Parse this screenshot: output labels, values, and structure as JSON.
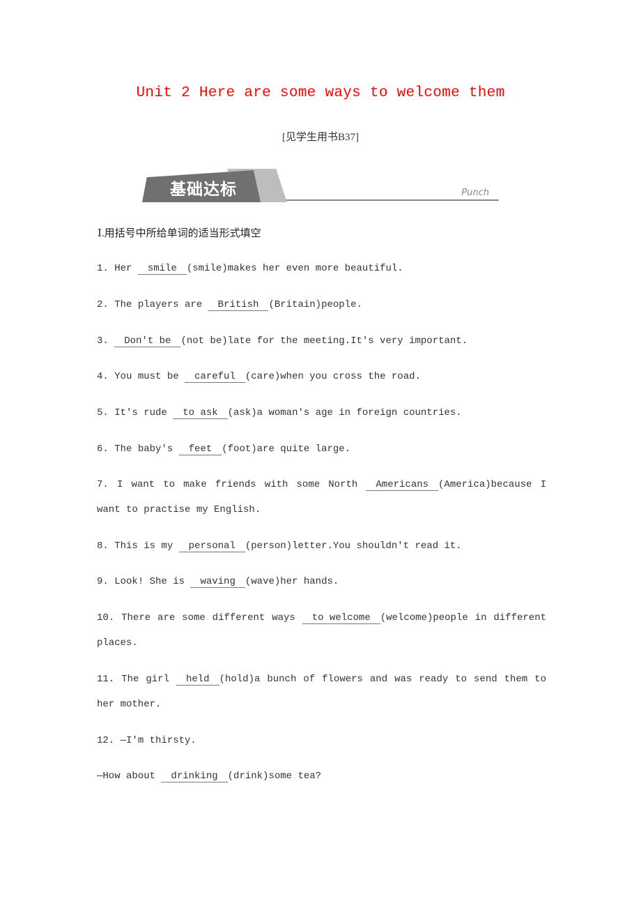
{
  "title": "Unit 2 Here are some ways to welcome them",
  "reference": "[见学生用书B37]",
  "banner": {
    "label": "基础达标",
    "tag": "Punch"
  },
  "section_heading": "Ⅰ.用括号中所给单词的适当形式填空",
  "questions": [
    {
      "num": "1.",
      "before": "Her",
      "answer": "smile",
      "after": "(smile)makes her even more beautiful."
    },
    {
      "num": "2.",
      "before": "The players are",
      "answer": "British",
      "after": "(Britain)people."
    },
    {
      "num": "3.",
      "before": "",
      "answer": "Don't be",
      "after": "(not be)late for the meeting.It's very important."
    },
    {
      "num": "4.",
      "before": "You must be",
      "answer": "careful",
      "after": "(care)when you cross the road."
    },
    {
      "num": "5.",
      "before": "It's rude",
      "answer": "to ask",
      "after": "(ask)a woman's age in foreign countries."
    },
    {
      "num": "6.",
      "before": "The baby's",
      "answer": "feet",
      "after": "(foot)are quite large."
    },
    {
      "num": "7.",
      "before": "I want to make friends with some North",
      "answer": "Americans",
      "after": "(America)because I want to practise my English."
    },
    {
      "num": "8.",
      "before": "This is my",
      "answer": "personal",
      "after": "(person)letter.You shouldn't read it."
    },
    {
      "num": "9.",
      "before": "Look! She is",
      "answer": "waving",
      "after": "(wave)her hands."
    },
    {
      "num": "10.",
      "before": "There are some different ways",
      "answer": "to welcome",
      "after": "(welcome)people in different places."
    },
    {
      "num": "11.",
      "before": "The girl",
      "answer": "held",
      "after": "(hold)a bunch of flowers and was ready to send them to her mother."
    },
    {
      "num": "12.",
      "before": "—I'm thirsty.",
      "answer": "",
      "after": ""
    },
    {
      "num": "",
      "before": "—How about",
      "answer": "drinking",
      "after": "(drink)some tea?"
    }
  ]
}
